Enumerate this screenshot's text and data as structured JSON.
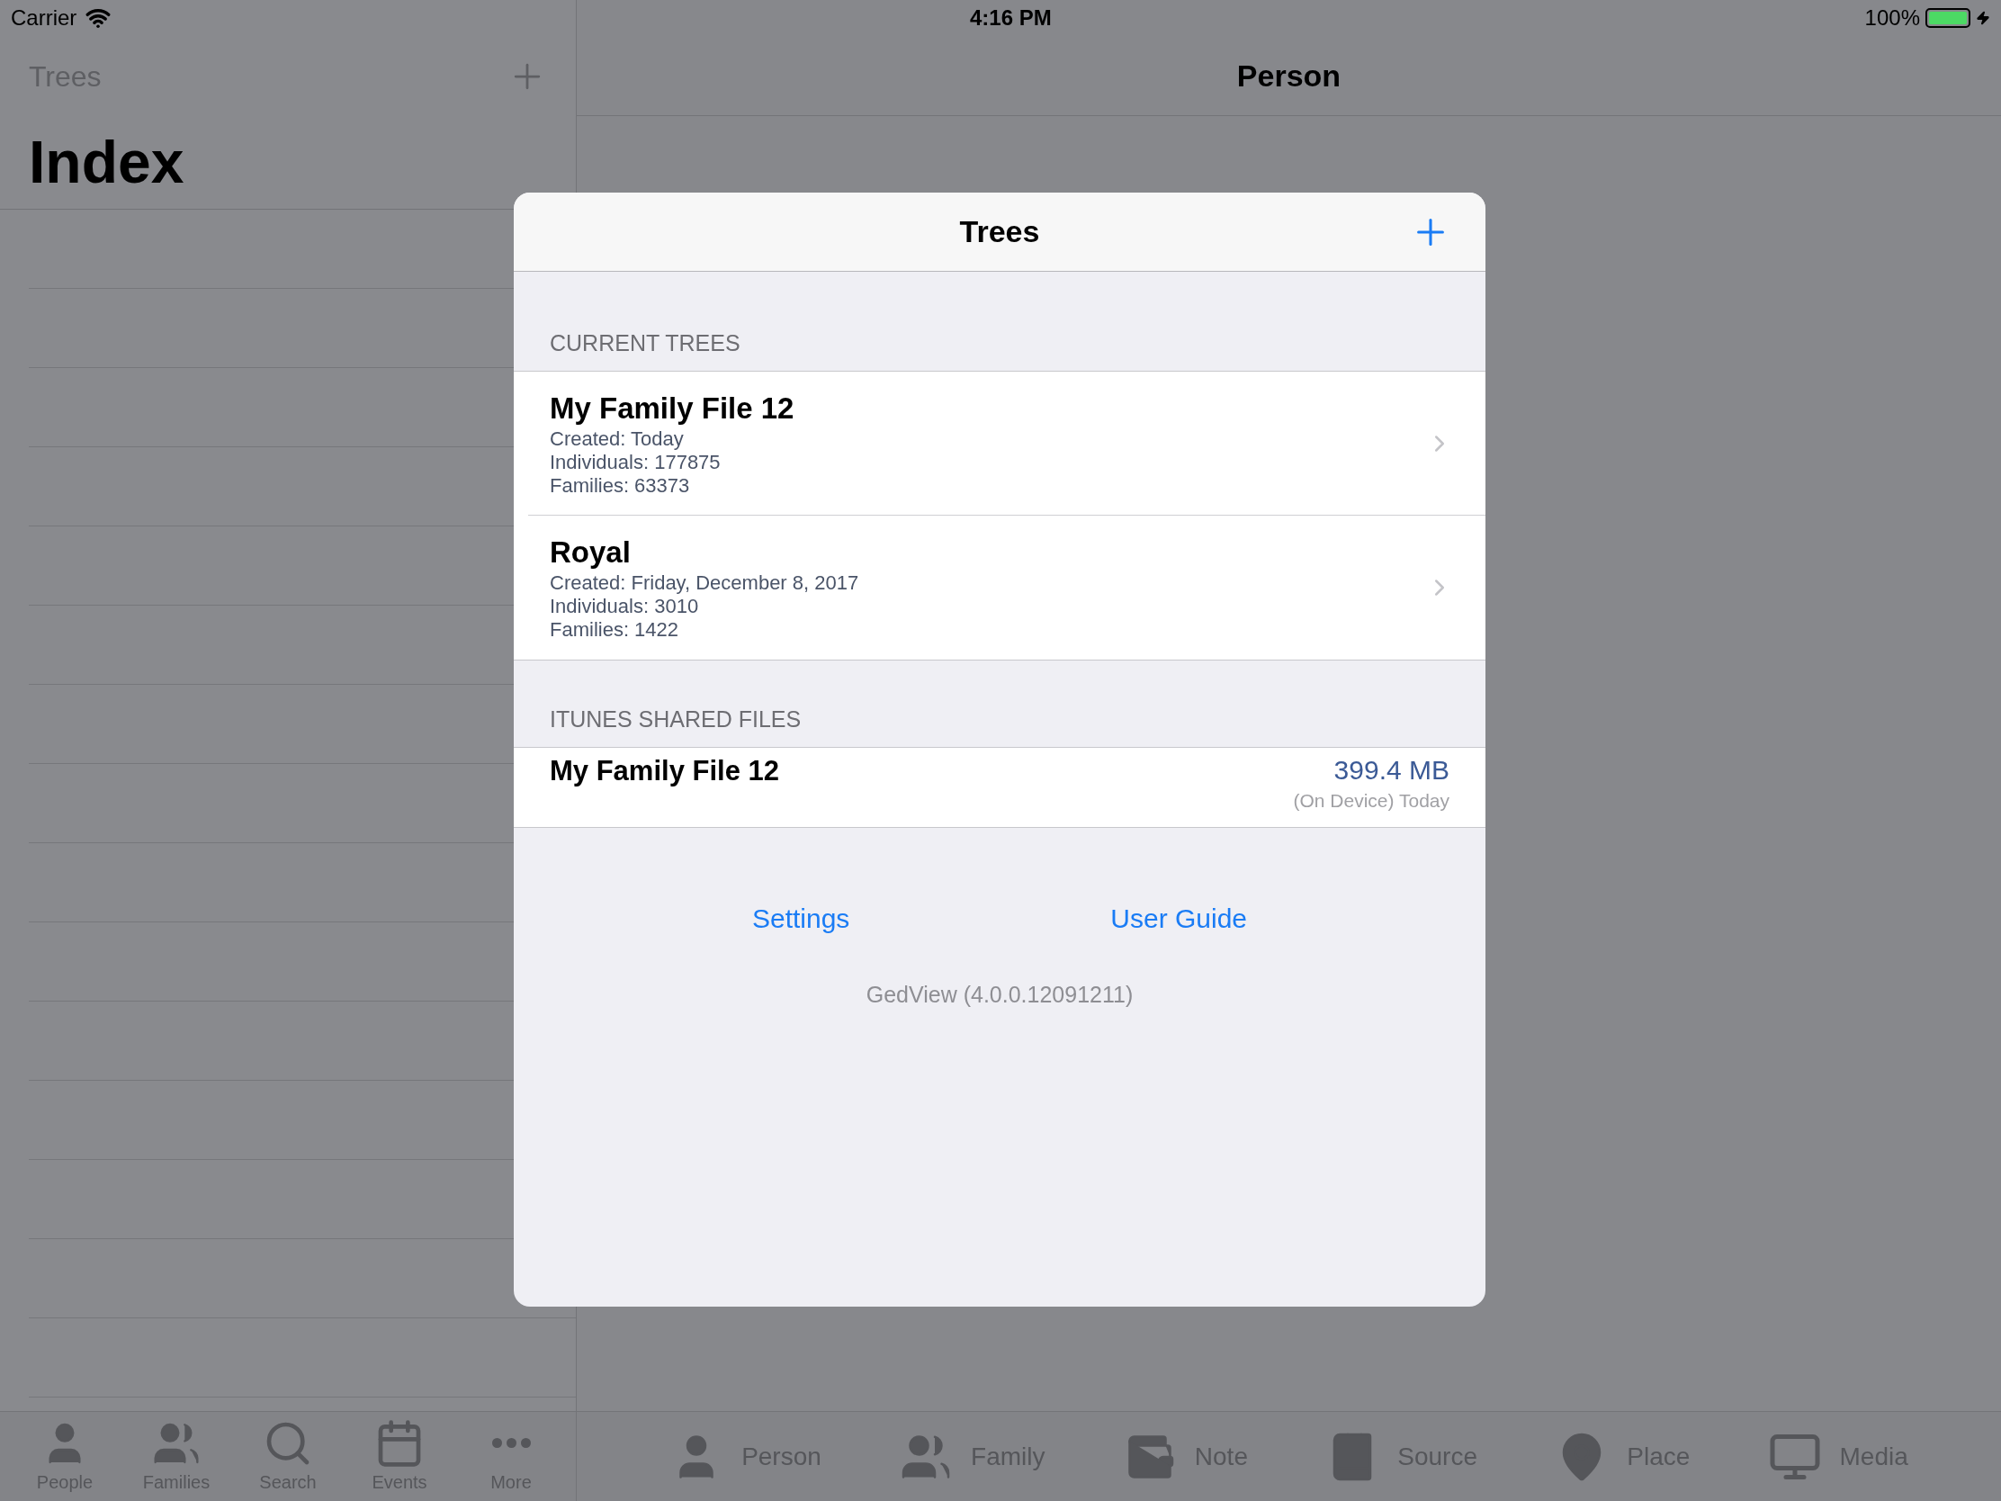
{
  "status_bar": {
    "carrier": "Carrier",
    "time": "4:16 PM",
    "battery": "100%"
  },
  "sidebar": {
    "back": "Trees",
    "title": "Index",
    "tabs": [
      {
        "label": "People"
      },
      {
        "label": "Families"
      },
      {
        "label": "Search"
      },
      {
        "label": "Events"
      },
      {
        "label": "More"
      }
    ]
  },
  "detail": {
    "title": "Person",
    "tabs": [
      {
        "label": "Person"
      },
      {
        "label": "Family"
      },
      {
        "label": "Note"
      },
      {
        "label": "Source"
      },
      {
        "label": "Place"
      },
      {
        "label": "Media"
      }
    ]
  },
  "dialog": {
    "title": "Trees",
    "sections": [
      {
        "header": "CURRENT TREES",
        "kind": "trees",
        "items": [
          {
            "name": "My Family File 12",
            "details": [
              "Created: Today",
              "Individuals: 177875",
              "Families: 63373"
            ]
          },
          {
            "name": "Royal",
            "details": [
              "Created: Friday, December 8, 2017",
              "Individuals: 3010",
              "Families: 1422"
            ]
          }
        ]
      },
      {
        "header": "ITUNES SHARED FILES",
        "kind": "files",
        "items": [
          {
            "name": "My Family File 12",
            "size": "399.4 MB",
            "location": "(On Device) Today"
          }
        ]
      }
    ],
    "links": [
      "Settings",
      "User Guide"
    ],
    "version": "GedView (4.0.0.12091211)"
  }
}
